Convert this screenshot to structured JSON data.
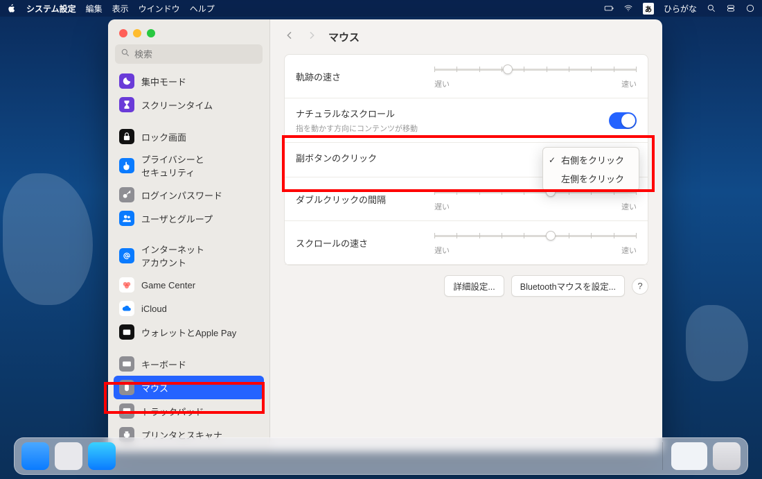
{
  "menubar": {
    "app_name": "システム設定",
    "items": [
      "編集",
      "表示",
      "ウインドウ",
      "ヘルプ"
    ],
    "ime_label": "あ",
    "ime_mode": "ひらがな"
  },
  "window": {
    "title": "マウス",
    "search_placeholder": "検索"
  },
  "sidebar": {
    "items": [
      {
        "label": "集中モード",
        "icon": "moon",
        "bg": "#6a3bd8",
        "fg": "#fff"
      },
      {
        "label": "スクリーンタイム",
        "icon": "hourglass",
        "bg": "#6a3bd8",
        "fg": "#fff"
      },
      {
        "sep": true
      },
      {
        "label": "ロック画面",
        "icon": "lock",
        "bg": "#111",
        "fg": "#fff"
      },
      {
        "label": "プライバシーと\nセキュリティ",
        "icon": "hand",
        "bg": "#0a7bff",
        "fg": "#fff"
      },
      {
        "label": "ログインパスワード",
        "icon": "key",
        "bg": "#8e8e93",
        "fg": "#fff"
      },
      {
        "label": "ユーザとグループ",
        "icon": "users",
        "bg": "#0a7bff",
        "fg": "#fff"
      },
      {
        "sep": true
      },
      {
        "label": "インターネット\nアカウント",
        "icon": "at",
        "bg": "#0a7bff",
        "fg": "#fff"
      },
      {
        "label": "Game Center",
        "icon": "gamecenter",
        "bg": "#fff",
        "fg": "#ff3b30"
      },
      {
        "label": "iCloud",
        "icon": "cloud",
        "bg": "#fff",
        "fg": "#0a7bff"
      },
      {
        "label": "ウォレットとApple Pay",
        "icon": "wallet",
        "bg": "#111",
        "fg": "#fff"
      },
      {
        "sep": true
      },
      {
        "label": "キーボード",
        "icon": "keyboard",
        "bg": "#8e8e93",
        "fg": "#fff"
      },
      {
        "label": "マウス",
        "icon": "mouse",
        "bg": "#8e8e93",
        "fg": "#fff",
        "selected": true
      },
      {
        "label": "トラックパッド",
        "icon": "trackpad",
        "bg": "#8e8e93",
        "fg": "#fff"
      },
      {
        "label": "プリンタとスキャナ",
        "icon": "printer",
        "bg": "#8e8e93",
        "fg": "#fff"
      }
    ]
  },
  "settings": {
    "tracking": {
      "label": "軌跡の速さ",
      "slow": "遅い",
      "fast": "速い",
      "value": 0.35
    },
    "natural": {
      "label": "ナチュラルなスクロール",
      "sub": "指を動かす方向にコンテンツが移動",
      "on": true
    },
    "secondary": {
      "label": "副ボタンのクリック",
      "options": [
        "右側をクリック",
        "左側をクリック"
      ],
      "selected": 0
    },
    "double": {
      "label": "ダブルクリックの間隔",
      "slow": "遅い",
      "fast": "速い",
      "value": 0.55
    },
    "scroll": {
      "label": "スクロールの速さ",
      "slow": "遅い",
      "fast": "速い",
      "value": 0.55
    }
  },
  "footer": {
    "advanced": "詳細設定...",
    "bt": "Bluetoothマウスを設定...",
    "help": "?"
  }
}
